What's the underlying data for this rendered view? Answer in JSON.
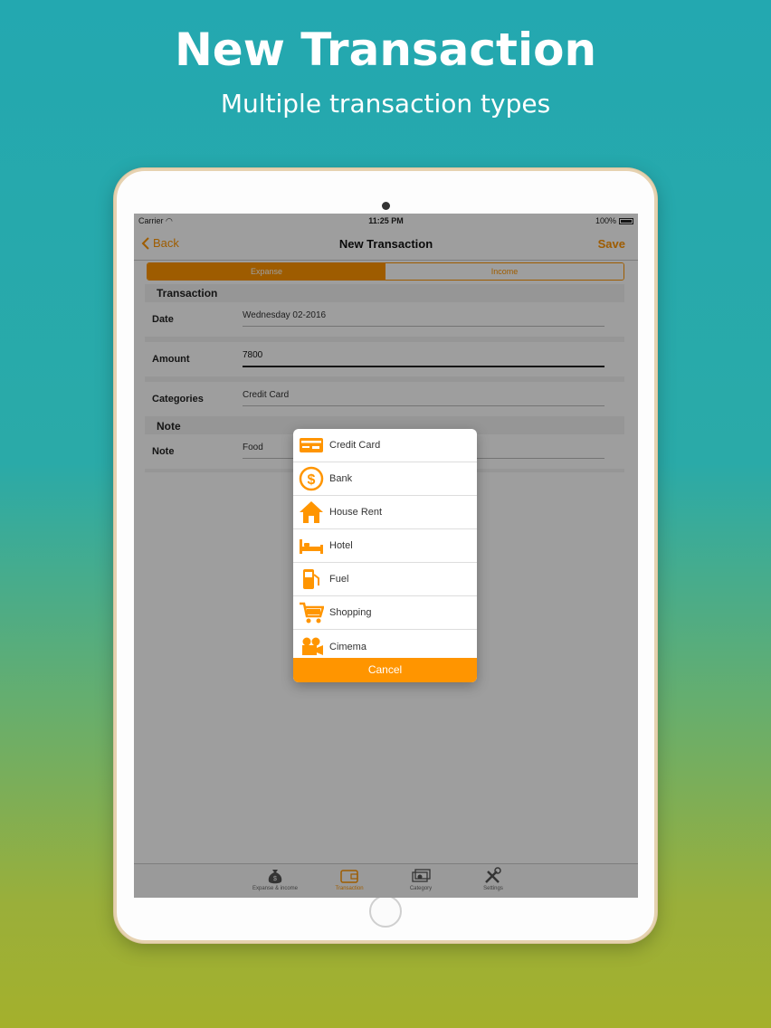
{
  "promo": {
    "title": "New Transaction",
    "subtitle": "Multiple transaction types"
  },
  "status_bar": {
    "carrier": "Carrier",
    "time": "11:25 PM",
    "battery": "100%"
  },
  "nav": {
    "back_label": "Back",
    "title": "New Transaction",
    "save_label": "Save"
  },
  "segment": {
    "options": [
      "Expanse",
      "Income"
    ],
    "selected": "Expanse"
  },
  "form": {
    "transaction_section": "Transaction",
    "date_label": "Date",
    "date_value": "Wednesday 02-2016",
    "amount_label": "Amount",
    "amount_value": "7800",
    "categories_label": "Categories",
    "categories_value": "Credit Card",
    "note_section": "Note",
    "note_label": "Note",
    "note_value": "Food"
  },
  "category_picker": {
    "items": [
      {
        "label": "Credit Card",
        "icon": "credit-card-icon"
      },
      {
        "label": "Bank",
        "icon": "dollar-circle-icon"
      },
      {
        "label": "House Rent",
        "icon": "house-icon"
      },
      {
        "label": "Hotel",
        "icon": "bed-icon"
      },
      {
        "label": "Fuel",
        "icon": "fuel-pump-icon"
      },
      {
        "label": "Shopping",
        "icon": "shopping-cart-icon"
      },
      {
        "label": "Cimema",
        "icon": "movie-camera-icon"
      }
    ],
    "cancel_label": "Cancel"
  },
  "tab_bar": {
    "tabs": [
      {
        "label": "Expanse & income",
        "icon": "money-bag-icon"
      },
      {
        "label": "Transaction",
        "icon": "wallet-icon"
      },
      {
        "label": "Category",
        "icon": "cash-stack-icon"
      },
      {
        "label": "Settings",
        "icon": "tools-icon"
      }
    ],
    "active": "Transaction"
  },
  "colors": {
    "accent": "#ff9500",
    "background_top": "#23a8b0",
    "background_bottom": "#a4b02c"
  }
}
